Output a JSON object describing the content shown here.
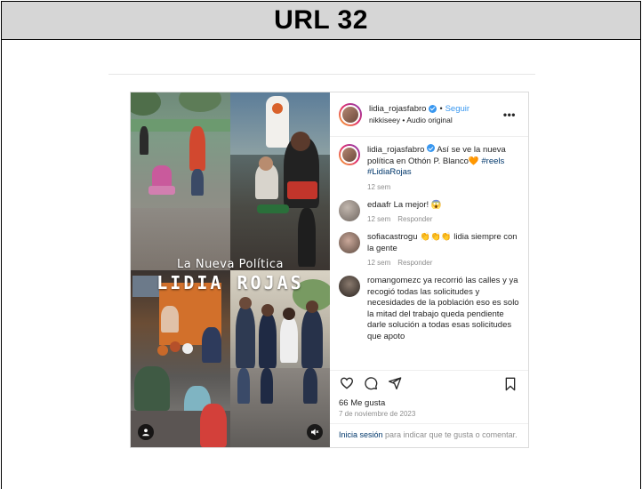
{
  "page": {
    "title": "URL 32"
  },
  "post": {
    "author": {
      "username": "lidia_rojasfabro",
      "verified_icon": "verified-badge-icon",
      "follow_label": "Seguir",
      "separator": "•"
    },
    "audio": {
      "owner": "nikkiseey",
      "separator": "•",
      "label": "Audio original"
    },
    "more_icon": "more-options-icon",
    "media": {
      "overlay_small": "La Nueva Política",
      "overlay_big": "LIDIA ROJAS",
      "user_tag_icon": "user-tag-icon",
      "mute_icon": "muted-speaker-icon"
    },
    "caption": {
      "username": "lidia_rojasfabro",
      "text": "Así se ve la nueva política en Othón P. Blanco",
      "emoji": "🧡",
      "hashtags": "#reels #LidiaRojas",
      "time": "12 sem"
    },
    "comments": [
      {
        "username": "edaafr",
        "text": "La mejor! 😱",
        "time": "12 sem",
        "reply_label": "Responder"
      },
      {
        "username": "sofiacastrogu",
        "text": "👏👏👏 lidia siempre con la gente",
        "time": "12 sem",
        "reply_label": "Responder"
      },
      {
        "username": "romangomezc",
        "text": "ya recorrió las calles y ya recogió todas las solicitudes y necesidades de la población eso es solo la mitad del trabajo queda pendiente darle solución a todas esas solicitudes que apoto"
      }
    ],
    "actions": {
      "like_icon": "heart-icon",
      "comment_icon": "comment-bubble-icon",
      "share_icon": "paper-plane-icon",
      "save_icon": "bookmark-icon"
    },
    "likes": "66 Me gusta",
    "date": "7 de noviembre de 2023",
    "login_prompt": {
      "link": "Inicia sesión",
      "text": " para indicar que te gusta o comentar."
    }
  },
  "colors": {
    "header_bg": "#d6d6d6",
    "link_blue": "#3897f0",
    "hashtag_blue": "#00376b",
    "muted_gray": "#8e8e8e"
  }
}
